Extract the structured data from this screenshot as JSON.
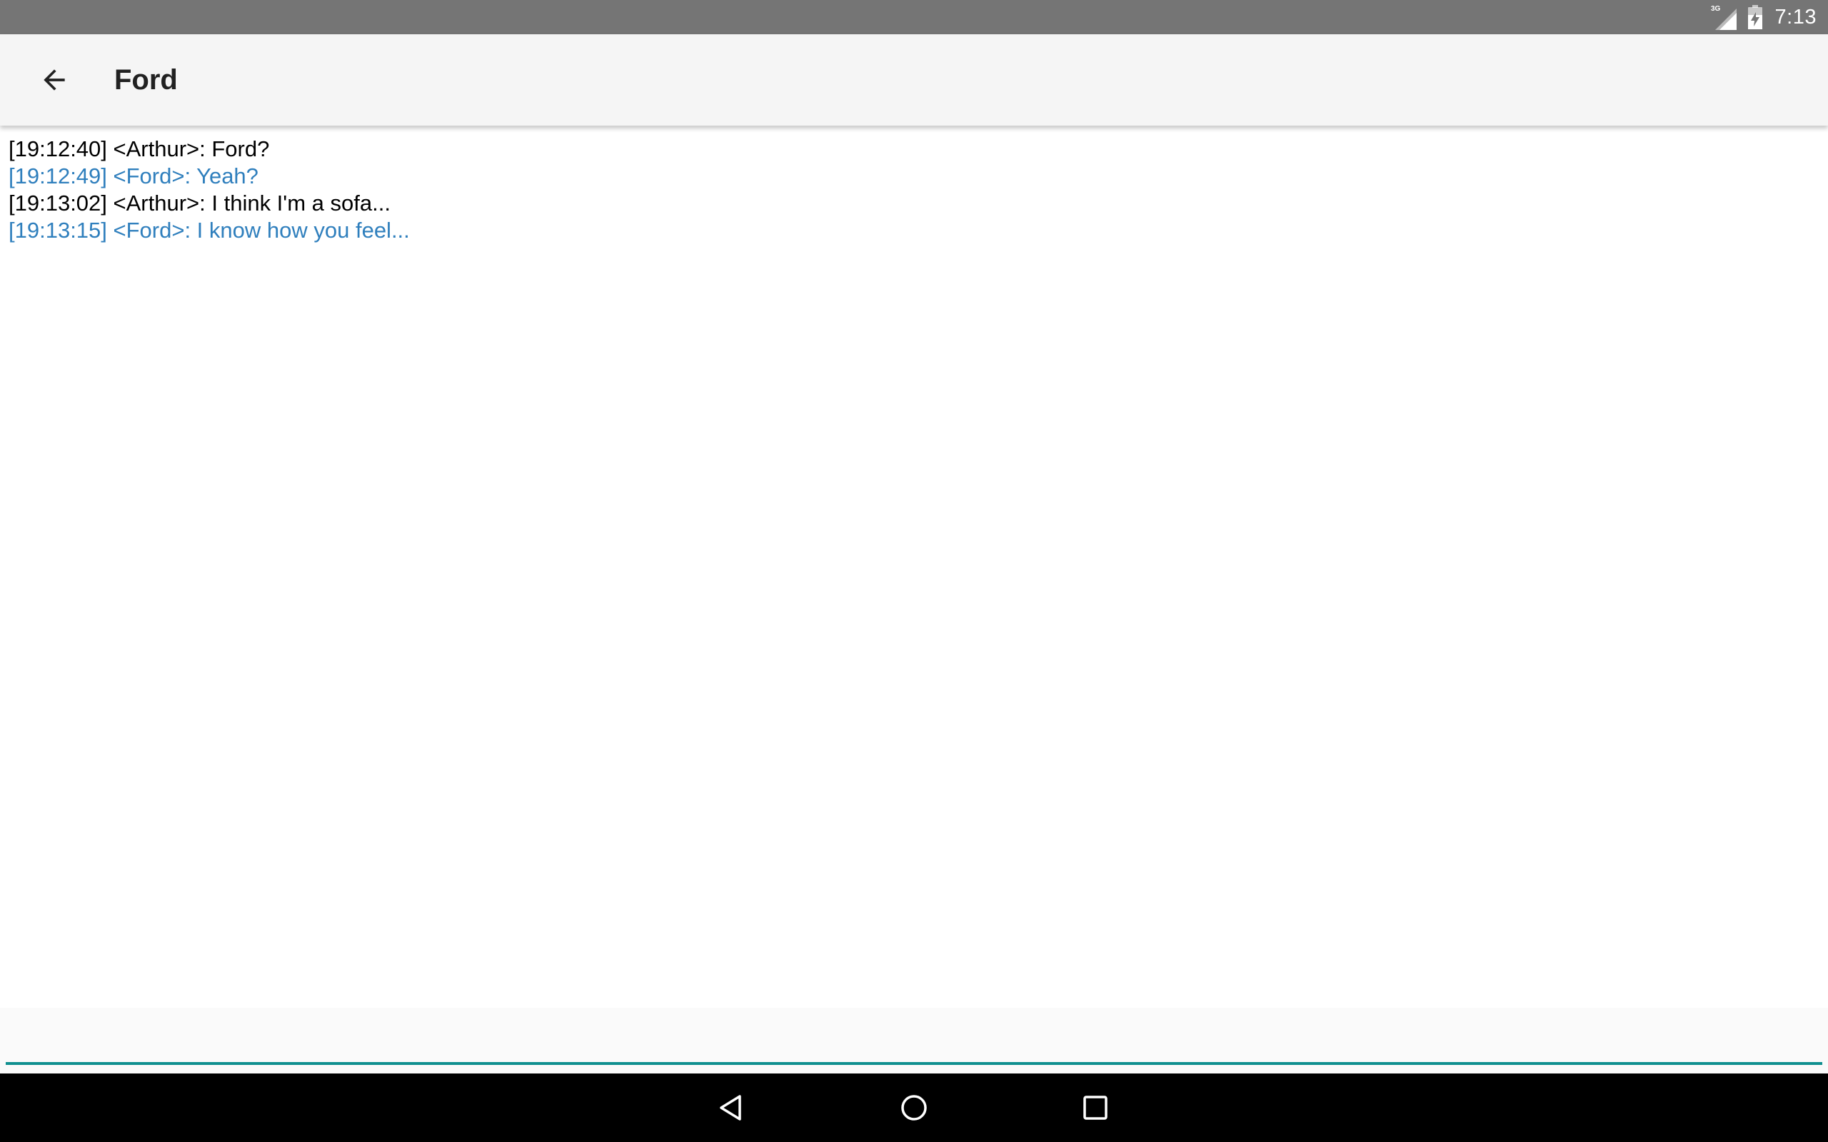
{
  "status_bar": {
    "network_label": "3G",
    "time": "7:13",
    "icons": [
      "signal-3g-icon",
      "battery-charging-icon"
    ]
  },
  "app_bar": {
    "title": "Ford",
    "back_icon": "arrow-back-icon"
  },
  "messages": [
    {
      "timestamp": "[19:12:40]",
      "sender": "<Arthur>",
      "text": "[19:12:40] <Arthur>: Ford?",
      "color": "#000000"
    },
    {
      "timestamp": "[19:12:49]",
      "sender": "<Ford>",
      "text": "[19:12:49] <Ford>: Yeah?",
      "color": "#2f7fbd"
    },
    {
      "timestamp": "[19:13:02]",
      "sender": "<Arthur>",
      "text": "[19:13:02] <Arthur>: I think I'm a sofa...",
      "color": "#000000"
    },
    {
      "timestamp": "[19:13:15]",
      "sender": "<Ford>",
      "text": "[19:13:15] <Ford>: I know how you feel...",
      "color": "#2f7fbd"
    }
  ],
  "composer": {
    "value": "",
    "placeholder": ""
  },
  "nav_bar": {
    "icons": [
      "nav-back-icon",
      "nav-home-icon",
      "nav-recents-icon"
    ]
  },
  "colors": {
    "status_bar": "#757575",
    "app_bar": "#f5f5f5",
    "accent": "#0f8f8f",
    "self_message": "#000000",
    "other_message": "#2f7fbd",
    "nav_bar": "#000000"
  }
}
